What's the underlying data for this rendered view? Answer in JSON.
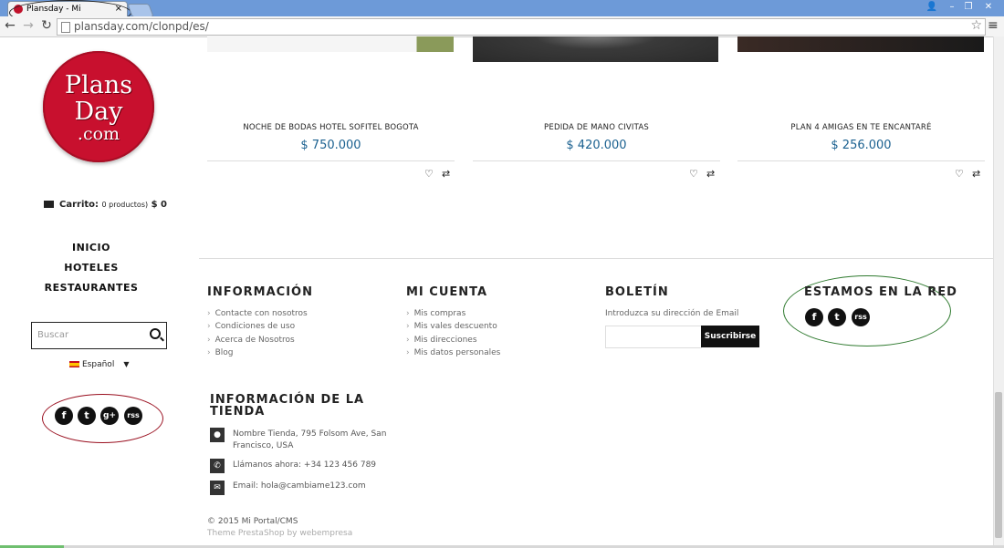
{
  "browser": {
    "tab_title": "Plansday - Mi Portal/CMS",
    "tab_close": "×",
    "url": "plansday.com/clonpd/es/",
    "win_user": "👤",
    "win_min": "–",
    "win_max": "❐",
    "win_close": "✕"
  },
  "logo": {
    "line1": "Plans",
    "line2": "Day",
    "line3": ".com"
  },
  "cart": {
    "label": "Carrito:",
    "count": "0 productos)",
    "total": "$ 0"
  },
  "nav": [
    "INICIO",
    "HOTELES",
    "RESTAURANTES"
  ],
  "search": {
    "placeholder": "Buscar"
  },
  "language": {
    "selected": "Español"
  },
  "side_social": [
    "f",
    "t",
    "g+",
    "rss"
  ],
  "products": [
    {
      "name": "NOCHE DE BODAS HOTEL SOFITEL BOGOTA",
      "price": "$ 750.000"
    },
    {
      "name": "PEDIDA DE MANO CIVITAS",
      "price": "$ 420.000"
    },
    {
      "name": "PLAN 4 AMIGAS EN TE ENCANTARÉ",
      "price": "$ 256.000"
    }
  ],
  "footer": {
    "info_title": "INFORMACIÓN",
    "info_links": [
      "Contacte con nosotros",
      "Condiciones de uso",
      "Acerca de Nosotros",
      "Blog"
    ],
    "account_title": "MI CUENTA",
    "account_links": [
      "Mis compras",
      "Mis vales descuento",
      "Mis direcciones",
      "Mis datos personales"
    ],
    "newsletter_title": "BOLETÍN",
    "newsletter_label": "Introduzca su dirección de Email",
    "subscribe": "Suscribirse",
    "social_title": "ESTAMOS EN LA RED",
    "social": [
      "f",
      "t",
      "rss"
    ],
    "store_title_1": "INFORMACIÓN DE LA",
    "store_title_2": "TIENDA",
    "store_address_1": "Nombre Tienda, 795 Folsom Ave, San",
    "store_address_2": "Francisco, USA",
    "store_phone": "Llámanos ahora: +34 123 456 789",
    "store_email": "Email: hola@cambiame123.com",
    "copyright": "© 2015 Mi Portal/CMS",
    "theme": "Theme PrestaShop by webempresa"
  }
}
